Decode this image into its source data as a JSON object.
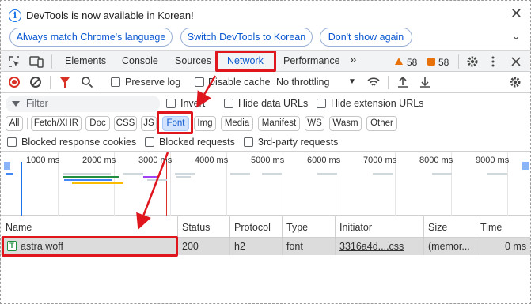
{
  "infobar": {
    "message": "DevTools is now available in Korean!",
    "buttons": [
      "Always match Chrome's language",
      "Switch DevTools to Korean",
      "Don't show again"
    ],
    "close_glyph": "✕",
    "chevron_glyph": "⌄"
  },
  "tabs": {
    "elements": "Elements",
    "console": "Console",
    "sources": "Sources",
    "network": "Network",
    "performance": "Performance",
    "more_glyph": "»",
    "warnings": "58",
    "errors": "58"
  },
  "toolbar": {
    "preserve_log": "Preserve log",
    "disable_cache": "Disable cache",
    "throttling": "No throttling",
    "throttle_arrow": "▼"
  },
  "filter": {
    "placeholder": "Filter",
    "invert": "Invert",
    "hide_data_urls": "Hide data URLs",
    "hide_extension_urls": "Hide extension URLs"
  },
  "type_chips": [
    "All",
    "Fetch/XHR",
    "Doc",
    "CSS",
    "JS",
    "Font",
    "Img",
    "Media",
    "Manifest",
    "WS",
    "Wasm",
    "Other"
  ],
  "selected_chip": "Font",
  "blocked": {
    "blocked_cookies": "Blocked response cookies",
    "blocked_requests": "Blocked requests",
    "third_party": "3rd-party requests"
  },
  "overview_ticks": [
    "1000 ms",
    "2000 ms",
    "3000 ms",
    "4000 ms",
    "5000 ms",
    "6000 ms",
    "7000 ms",
    "8000 ms",
    "9000 ms"
  ],
  "table": {
    "columns": [
      "Name",
      "Status",
      "Protocol",
      "Type",
      "Initiator",
      "Size",
      "Time"
    ],
    "rows": [
      {
        "name": "astra.woff",
        "status": "200",
        "protocol": "h2",
        "type": "font",
        "initiator": "3316a4d....css",
        "size": "(memor...",
        "time": "0 ms"
      }
    ]
  },
  "colors": {
    "accent": "#0b57d0",
    "annotation": "#e0161f",
    "record": "#d93025",
    "warning": "#e8710a"
  }
}
